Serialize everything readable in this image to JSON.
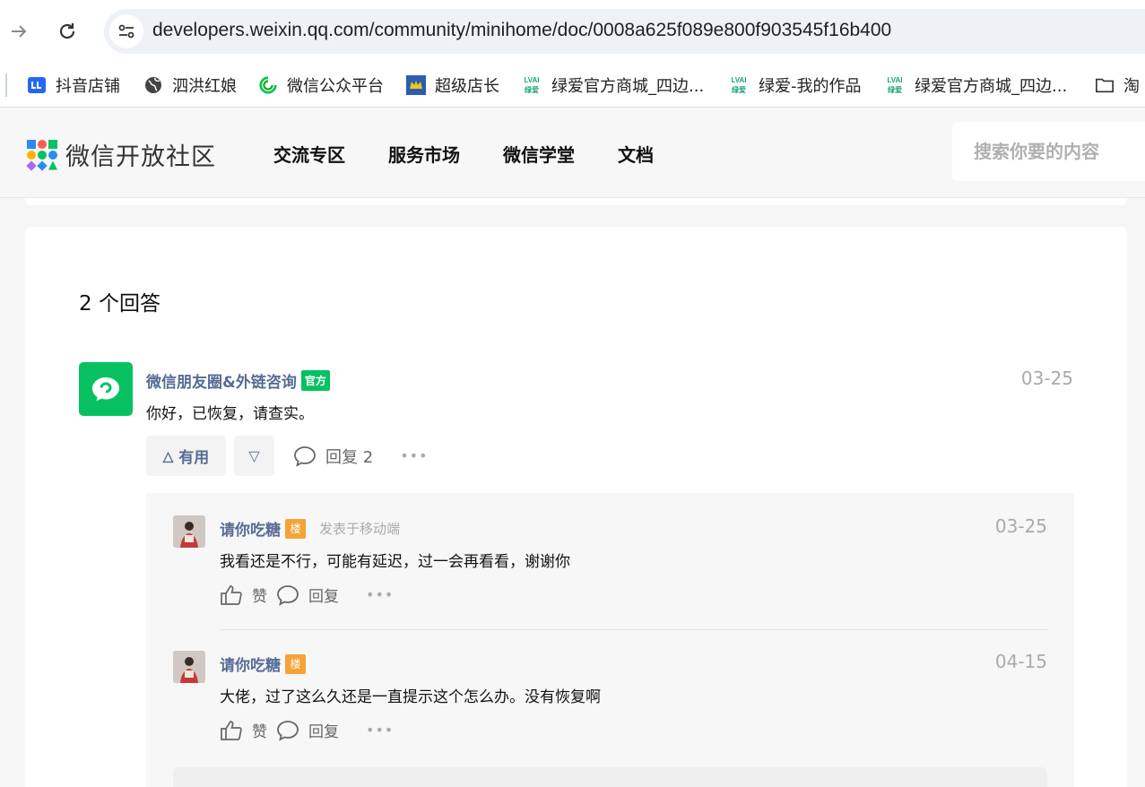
{
  "browser": {
    "url": "developers.weixin.qq.com/community/minihome/doc/0008a625f089e800f903545f16b400",
    "bookmarks": [
      {
        "label": "抖音店铺",
        "icon": "douyin-shop-icon"
      },
      {
        "label": "泗洪红娘",
        "icon": "globe-icon"
      },
      {
        "label": "微信公众平台",
        "icon": "wechat-mp-icon"
      },
      {
        "label": "超级店长",
        "icon": "crown-icon"
      },
      {
        "label": "绿爱官方商城_四边...",
        "icon": "lvai-icon"
      },
      {
        "label": "绿爱-我的作品",
        "icon": "lvai-icon"
      },
      {
        "label": "绿爱官方商城_四边...",
        "icon": "lvai-icon"
      },
      {
        "label": "淘",
        "icon": "folder-icon"
      }
    ]
  },
  "header": {
    "logo_text": "微信开放社区",
    "nav": [
      "交流专区",
      "服务市场",
      "微信学堂",
      "文档"
    ],
    "search_placeholder": "搜索你要的内容"
  },
  "answers": {
    "title": "2 个回答",
    "items": [
      {
        "author": "微信朋友圈&外链咨询",
        "badge": "官方",
        "date": "03-25",
        "content": "你好，已恢复，请查实。",
        "useful_label": "有用",
        "reply_label": "回复 2",
        "replies": [
          {
            "author": "请你吃糖",
            "badge": "楼",
            "source": "发表于移动端",
            "date": "03-25",
            "content": "我看还是不行，可能有延迟，过一会再看看，谢谢你",
            "like_label": "赞",
            "reply_label": "回复"
          },
          {
            "author": "请你吃糖",
            "badge": "楼",
            "source": "",
            "date": "04-15",
            "content": "大佬，过了这么久还是一直提示这个怎么办。没有恢复啊",
            "like_label": "赞",
            "reply_label": "回复"
          }
        ]
      }
    ]
  },
  "colors": {
    "brand_green": "#07c160",
    "link_blue": "#576b95",
    "floor_badge": "#f5a337"
  }
}
